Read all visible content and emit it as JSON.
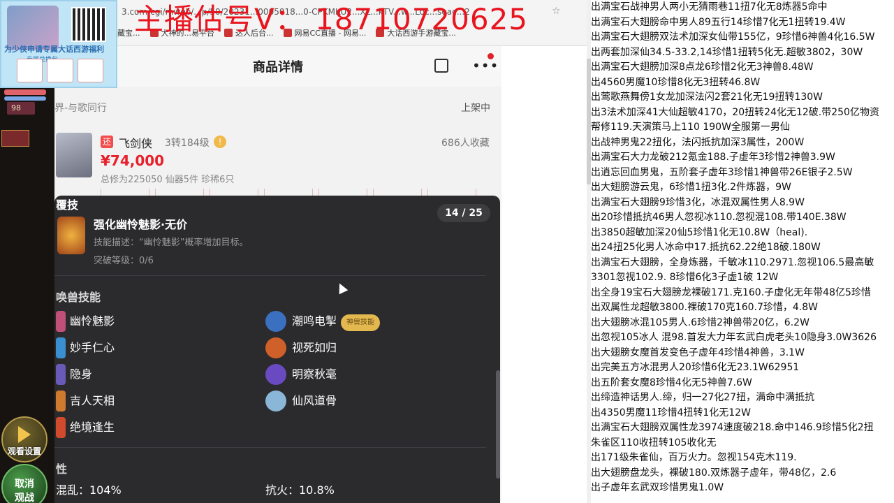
{
  "overlay": {
    "streamer_text": "主播估号V： 18710720625"
  },
  "promo": {
    "title": "为少侠申请专属大话西游福利",
    "sub": "专属兑换包"
  },
  "browser": {
    "url": "3.com/cgi/mweb/...p/50/20231...0005018...0-CPKMKU2...XL...kTV...w...Loc...seac...2",
    "bookmarks": [
      "藏宝...",
      "大神的...易平台",
      "达人后台...",
      "网易CC直播 - 网易...",
      "大话西游手游藏宝..."
    ]
  },
  "game": {
    "level": "98",
    "watch_setting": "观看设置",
    "cancel_label_1": "取消",
    "cancel_label_2": "观战"
  },
  "page": {
    "title": "商品详情",
    "server": "界-与歌同行",
    "status": "上架中",
    "tag": "还",
    "char_name": "飞剑侠",
    "char_level": "3转184级",
    "favorites": "686人收藏",
    "price": "¥74,000",
    "summary": "总修为225050  仙器5件  珍稀6只"
  },
  "sheet": {
    "section_skill": "覆技",
    "counter": "14 / 25",
    "skill_name": "强化幽怜魅影·无价",
    "skill_desc": "技能描述：“幽怜魅影”概率增加目标。",
    "skill_level": "突破等级：0/6",
    "section_pet_skills": "唤兽技能",
    "pet_skills_left": [
      "幽怜魅影",
      "妙手仁心",
      "隐身",
      "吉人天相",
      "绝境逢生"
    ],
    "pet_skills_right": [
      "潮鸣电掣",
      "视死如归",
      "明察秋毫",
      "仙风道骨"
    ],
    "badge": "神兽技能",
    "section_attr": "性",
    "attr_left": "混乱：104%",
    "attr_right": "抗火：10.8%"
  },
  "rlist": [
    "出满宝石战神男人两小无猜雨巷11扭7化无8炼器5命中",
    "出满宝石大翅膀命中男人89五行14珍惜7化无1扭转19.4W",
    "出满宝石大翅膀双法术加深女仙带155亿，9珍惜6神兽4化16.5W",
    "出两套加深仙34.5-33.2,14珍惜1扭转5化无.超敏3802，30W",
    "出满宝石大翅膀加深8点龙6珍惜2化无3神兽8.48W",
    "出4560男魔10珍惜8化无3扭转46.8W",
    "出莺歌燕舞傍1女龙加深法闪2套21化无19扭转130W",
    "出3法术加深41大仙超敏4170，20扭转24化无12破.带250亿物资",
    "帮修119.天演策马上110 190W全服第一男仙",
    "出战神男鬼22扭化，法闪抵抗加深3属性，200W",
    "出满宝石大力龙破212氪金188.子虚年3珍惜2神兽3.9W",
    "出逍忘回血男鬼，五阶套子虚年3珍惜1神兽带26E银子2.5W",
    "出大翅膀游云鬼，6珍惜1扭3化.2件炼器，9W",
    "出满宝石大翅膀9珍惜3化，冰混双属性男人8.9W",
    "出20珍惜抵抗46男人忽视冰110.忽视混108.带140E.38W",
    "出3850超敏加深20仙5珍惜1化无10.8W（heal).",
    "出24扭25化男人冰命中17.抵抗62.22绝18破.180W",
    "出满宝石大翅膀，全身炼器，千敏冰110.2971.忽视106.5最高敏",
    "3301忽视102.9. 8珍惜6化3子虚1破  12W",
    "出全身19宝石大翅膀龙裸破171.克160.子虚化无年带48亿5珍惜",
    "出双属性龙超敏3800.裸破170克160.7珍惜，4.8W",
    "出大翅膀冰混105男人.6珍惜2神兽带20亿，6.2W",
    "出忽视105冰人 混98.首发大力年玄武白虎老头10隐身3.0W3626",
    "出大翅膀女魔首发变色子虚年4珍惜4神兽，3.1W",
    "出完美五方冰混男人20珍惜6化无23.1W62951",
    "出五阶套女魔8珍惜4化无5神兽7.6W",
    "出缔造神话男人.缔，归一27化27扭，满命中满抵抗",
    "出4350男魔11珍惜4扭转1化无12W",
    "出满宝石大翅膀双属性龙3974速度破218.命中146.9珍惜5化2扭",
    "朱雀区110收扭转105收化无",
    "出171级朱雀仙，百万火力。忽视154克木119.",
    "出大翅膀盘龙头，裸破180.双炼器子虚年，带48亿，2.6",
    "出子虚年玄武双珍惜男鬼1.0W"
  ]
}
